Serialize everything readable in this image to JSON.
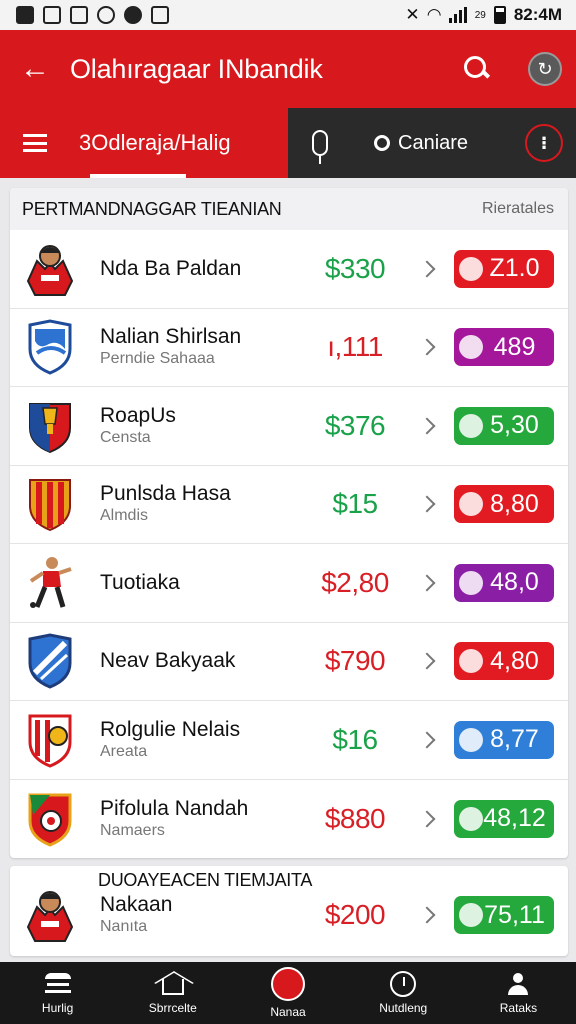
{
  "status_bar": {
    "time": "82:4M",
    "signal_text": "29"
  },
  "app_bar": {
    "back_label": "←",
    "title": "Olahıragaar INbandik",
    "profile_icon": "↻"
  },
  "tabs": {
    "active_label": "3Odleraja/Halig",
    "compare_label": "Caniare",
    "more_label": "⁝"
  },
  "list": {
    "title": "PERTMANDNAGGAR TIEANIAN",
    "action_label": "Rieratales",
    "rows": [
      {
        "name": "Nda Ba Paldan",
        "sub": "",
        "price": "$330",
        "price_color": "#1aa24a",
        "badge": "Z1.0",
        "badge_color": "#e21b22",
        "logo": "player-avatar"
      },
      {
        "name": "Nalian Shirlsan",
        "sub": "Perndie Sahaaa",
        "price": "ı,111",
        "price_color": "#d81f26",
        "badge": "489",
        "badge_color": "#a4179b",
        "logo": "shield-blue"
      },
      {
        "name": "RoapUs",
        "sub": "Censta",
        "price": "$376",
        "price_color": "#1aa24a",
        "badge": "5,30",
        "badge_color": "#25a83c",
        "logo": "shield-trophy"
      },
      {
        "name": "Punlsda Hasa",
        "sub": "Almdis",
        "price": "$15",
        "price_color": "#1aa24a",
        "badge": "8,80",
        "badge_color": "#e21b22",
        "logo": "shield-stripes"
      },
      {
        "name": "Tuotiaka",
        "sub": "",
        "price": "$2,80",
        "price_color": "#d81f26",
        "badge": "48,0",
        "badge_color": "#8a1fa6",
        "logo": "player-figure"
      },
      {
        "name": "Neav Bakyaak",
        "sub": "",
        "price": "$790",
        "price_color": "#d81f26",
        "badge": "4,80",
        "badge_color": "#e21b22",
        "logo": "shield-blue-white"
      },
      {
        "name": "Rolgulie Nelais",
        "sub": "Areata",
        "price": "$16",
        "price_color": "#1aa24a",
        "badge": "8,77",
        "badge_color": "#2f7fd8",
        "logo": "shield-red-white"
      },
      {
        "name": "Pifolula Nandah",
        "sub": "Namaers",
        "price": "$880",
        "price_color": "#d81f26",
        "badge": "48,12",
        "badge_color": "#25a83c",
        "logo": "shield-green-red"
      }
    ]
  },
  "second": {
    "title": "DUOAYEACEN TIEMJAITA",
    "row": {
      "name": "Nakaan",
      "sub": "Nanıta",
      "price": "$200",
      "price_color": "#d81f26",
      "badge": "75,11",
      "badge_color": "#25a83c",
      "logo": "player-avatar"
    }
  },
  "bottom_nav": [
    {
      "label": "Hurlig",
      "icon": "bank-icon"
    },
    {
      "label": "Sbrrcelte",
      "icon": "home-icon"
    },
    {
      "label": "Nanaa",
      "icon": "center-icon"
    },
    {
      "label": "Nutdleng",
      "icon": "clock-icon"
    },
    {
      "label": "Rataks",
      "icon": "user-icon"
    }
  ]
}
